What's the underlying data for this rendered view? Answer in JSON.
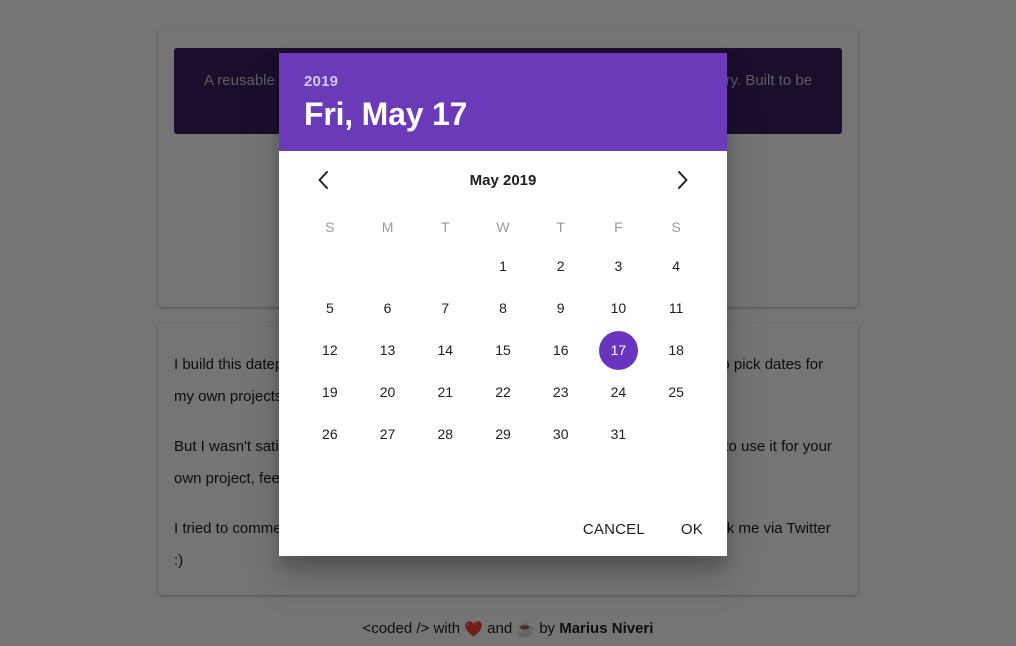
{
  "background": {
    "banner_text": "A reusable datepicker component built without jQuery, MomentJS or other library. Built to be lightweight and easy to integrate. Also only in",
    "paragraphs": [
      "I build this datepicker because I couldn't find a good vanilla project/React solution to pick dates for my own projects.",
      "But I wasn't satisfied with any existing library, so I decided to build one. If you want to use it for your own project, feel free.",
      "I tried to comment the code as much as possible. If you have questions, you can ask me via Twitter :)"
    ],
    "paragraph_3_link": "Twitter",
    "paragraph_3_suffix": " :)",
    "footer": {
      "prefix": "<coded /> with ",
      "heart_icon": "❤️",
      "middle": " and ",
      "coffee_icon": "☕",
      "suffix": " by ",
      "author": "Marius Niveri"
    }
  },
  "datepicker": {
    "header": {
      "year": "2019",
      "selected_date_label": "Fri, May 17"
    },
    "nav": {
      "prev_label": "‹",
      "next_label": "›",
      "month_label": "May 2019"
    },
    "weekdays": [
      "S",
      "M",
      "T",
      "W",
      "T",
      "F",
      "S"
    ],
    "weeks": [
      [
        "",
        "",
        "",
        "1",
        "2",
        "3",
        "4"
      ],
      [
        "5",
        "6",
        "7",
        "8",
        "9",
        "10",
        "11"
      ],
      [
        "12",
        "13",
        "14",
        "15",
        "16",
        "17",
        "18"
      ],
      [
        "19",
        "20",
        "21",
        "22",
        "23",
        "24",
        "25"
      ],
      [
        "26",
        "27",
        "28",
        "29",
        "30",
        "31",
        ""
      ]
    ],
    "selected_day": "17",
    "actions": {
      "cancel_label": "CANCEL",
      "ok_label": "OK"
    },
    "colors": {
      "header_purple": "#6A3AB8",
      "selected_purple": "#6A35BE",
      "banner_purple": "#3B2063",
      "scrim": "rgba(0,0,0,0.54)"
    }
  }
}
